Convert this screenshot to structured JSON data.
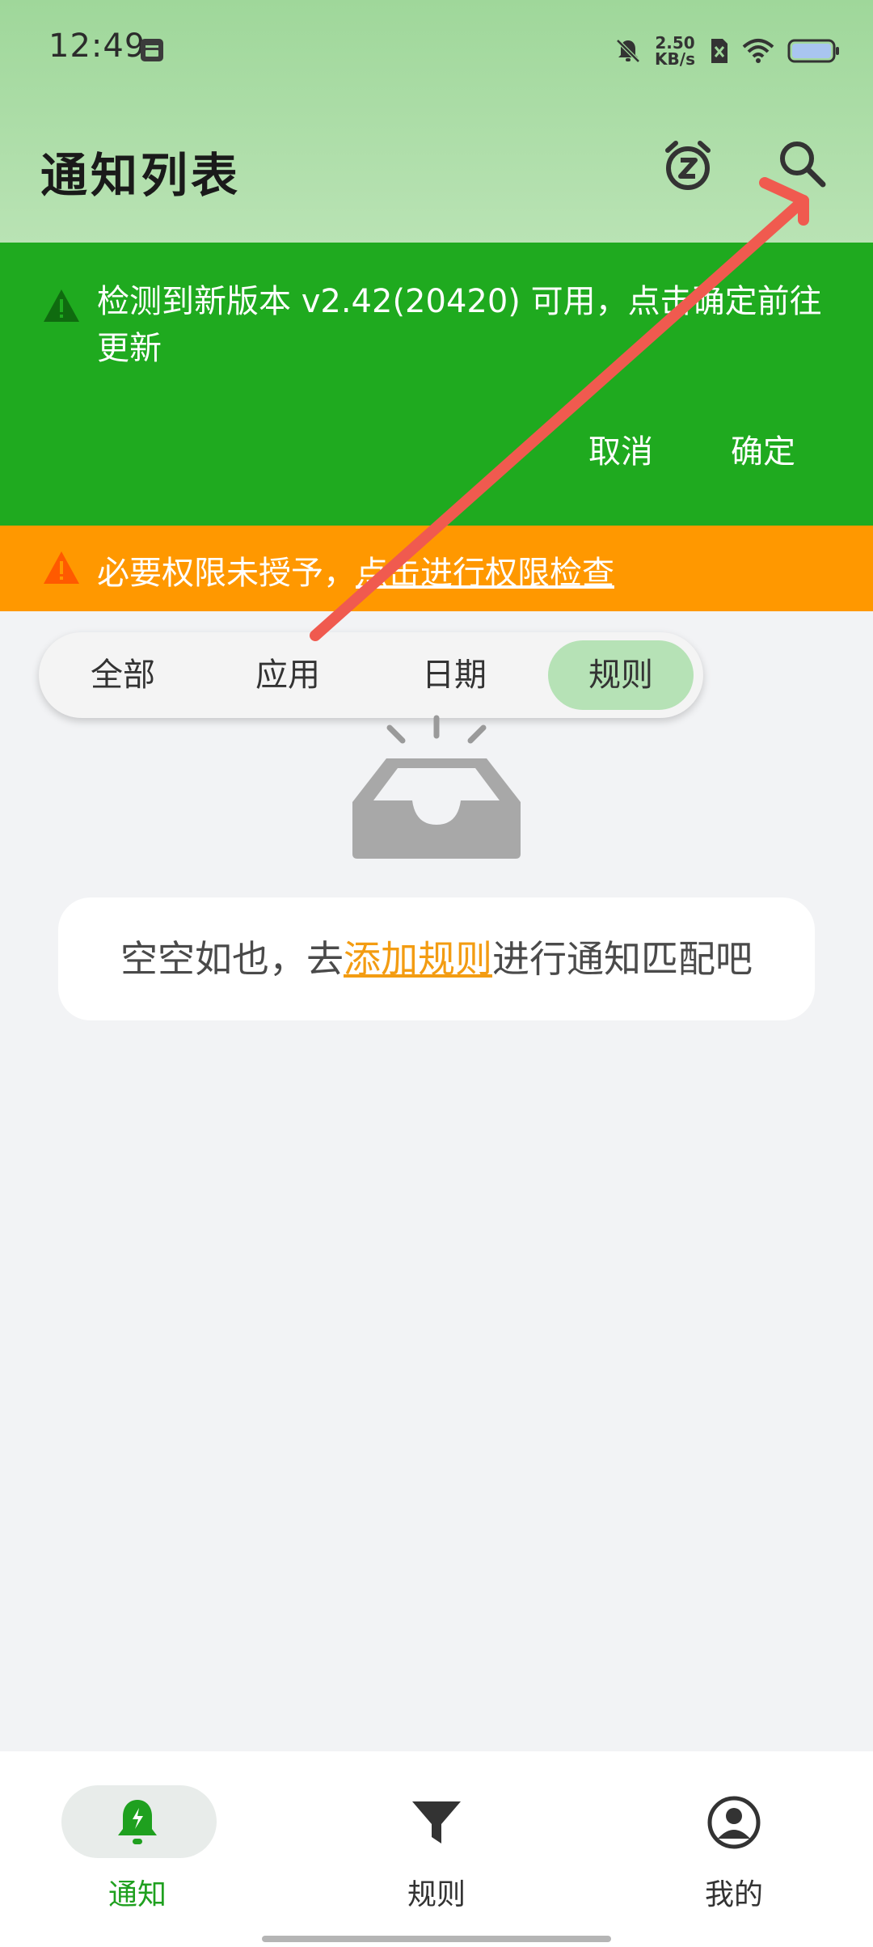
{
  "status_bar": {
    "time": "12:49",
    "network_speed_value": "2.50",
    "network_speed_unit": "KB/s",
    "icons": [
      "app-notification-icon",
      "mute-bell-icon",
      "sim-off-icon",
      "wifi-icon",
      "battery-icon"
    ]
  },
  "header": {
    "title": "通知列表",
    "actions": [
      "snooze-alarm-icon",
      "search-icon"
    ]
  },
  "update_banner": {
    "message": "检测到新版本 v2.42(20420) 可用，点击确定前往更新",
    "cancel_label": "取消",
    "confirm_label": "确定",
    "color": "#1faa1f"
  },
  "permission_banner": {
    "prefix": "必要权限未授予，",
    "link": "点击进行权限检查",
    "color": "#ff9800"
  },
  "tabs": [
    {
      "label": "全部",
      "active": false
    },
    {
      "label": "应用",
      "active": false
    },
    {
      "label": "日期",
      "active": false
    },
    {
      "label": "规则",
      "active": true
    }
  ],
  "empty_state": {
    "prefix": "空空如也，去",
    "link": "添加规则",
    "suffix": "进行通知匹配吧",
    "link_color": "#f39c12"
  },
  "bottom_nav": [
    {
      "label": "通知",
      "icon": "bell-icon",
      "active": true
    },
    {
      "label": "规则",
      "icon": "filter-icon",
      "active": false
    },
    {
      "label": "我的",
      "icon": "profile-icon",
      "active": false
    }
  ],
  "accent_color": "#1fa01f"
}
